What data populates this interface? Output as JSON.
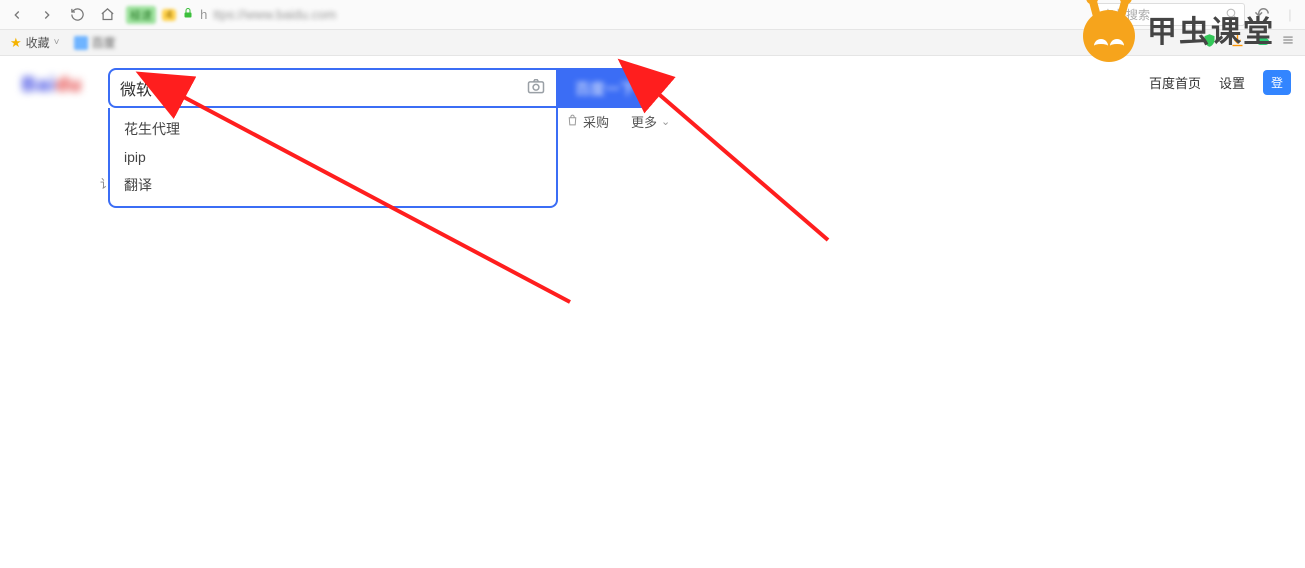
{
  "browser": {
    "badge_text": "極速",
    "badge_num": "4",
    "url_prefix": "h",
    "url_rest": "ttps://www.baidu.com",
    "top_search_placeholder": "点此搜索"
  },
  "bookmarks": {
    "fav_label": "收藏",
    "item1": "百度"
  },
  "page_top": {
    "home": "百度首页",
    "settings": "设置",
    "login": "登"
  },
  "logo": {
    "left": "Bai",
    "right": "du"
  },
  "search": {
    "value": "微软",
    "button": "百度一下"
  },
  "suggestions": [
    "花生代理",
    "ipip",
    "翻译"
  ],
  "nav": {
    "purchase": "采购",
    "more": "更多"
  },
  "helper_stub": "讠",
  "watermark": {
    "text": "甲虫课堂"
  }
}
